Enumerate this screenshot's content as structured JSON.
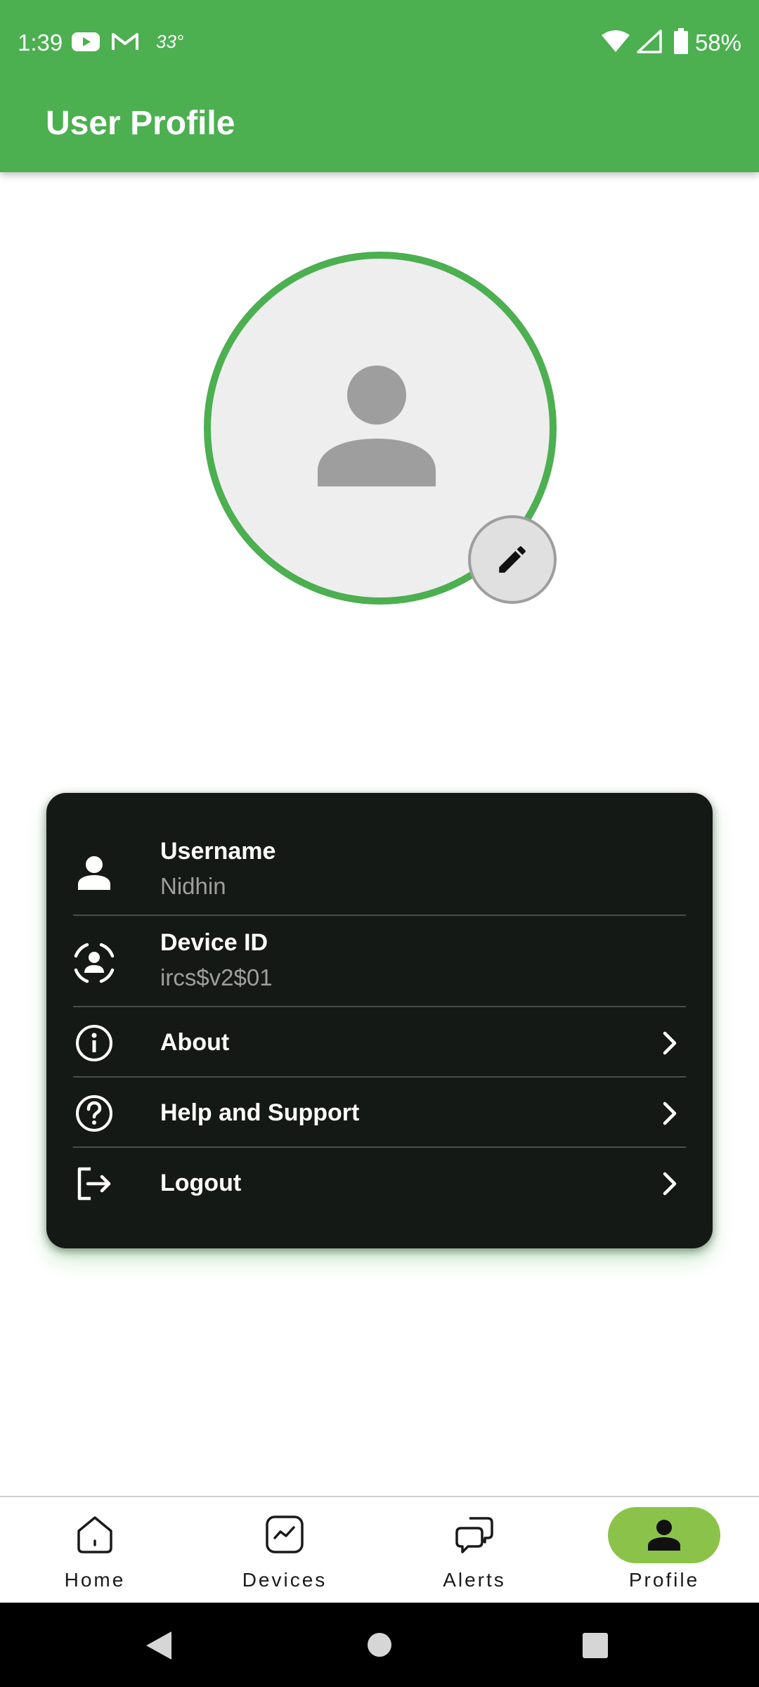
{
  "status_bar": {
    "time": "1:39",
    "temperature": "33°",
    "battery": "58%",
    "icons": [
      "youtube-icon",
      "gmail-icon",
      "wifi-icon",
      "signal-icon",
      "battery-icon"
    ]
  },
  "app_bar": {
    "title": "User Profile"
  },
  "colors": {
    "primary": "#4caf50",
    "nav_active": "#8bc34a",
    "card_bg": "#151915",
    "subtext": "#9e9e9e"
  },
  "profile": {
    "avatar_icon": "person-icon",
    "edit_icon": "pencil-icon"
  },
  "info_card": {
    "username": {
      "label": "Username",
      "value": "Nidhin",
      "icon": "person-icon"
    },
    "device_id": {
      "label": "Device ID",
      "value": "ircs$v2$01",
      "icon": "face-scan-icon"
    },
    "about": {
      "label": "About",
      "icon": "info-icon"
    },
    "help": {
      "label": "Help and Support",
      "icon": "help-icon"
    },
    "logout": {
      "label": "Logout",
      "icon": "logout-icon"
    }
  },
  "bottom_nav": {
    "items": [
      {
        "label": "Home",
        "icon": "home-icon",
        "active": false
      },
      {
        "label": "Devices",
        "icon": "chart-icon",
        "active": false
      },
      {
        "label": "Alerts",
        "icon": "chat-bubbles-icon",
        "active": false
      },
      {
        "label": "Profile",
        "icon": "person-icon",
        "active": true
      }
    ]
  }
}
